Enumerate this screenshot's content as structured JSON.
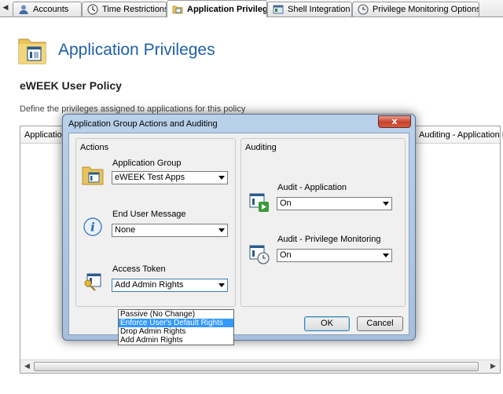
{
  "tabs": [
    {
      "label": "Accounts",
      "icon": "user-icon",
      "active": false
    },
    {
      "label": "Time Restrictions",
      "icon": "clock-icon",
      "active": false
    },
    {
      "label": "Application Privileges",
      "icon": "folder-icon",
      "active": true
    },
    {
      "label": "Shell Integration",
      "icon": "shell-icon",
      "active": false
    },
    {
      "label": "Privilege Monitoring Options",
      "icon": "monitor-clock-icon",
      "active": false
    }
  ],
  "header": {
    "title": "Application Privileges",
    "icon": "folder-app-icon",
    "policy_name": "eWEEK User Policy",
    "description": "Define the privileges assigned to applications for this policy"
  },
  "grid": {
    "columns": [
      "Application G",
      "Auditing - Application Laun"
    ]
  },
  "dialog": {
    "title": "Application Group Actions and Auditing",
    "close_label": "x",
    "actions": {
      "group_label": "Actions",
      "application_group": {
        "label": "Application Group",
        "value": "eWEEK Test Apps",
        "icon": "folder-app-icon"
      },
      "end_user_message": {
        "label": "End User Message",
        "value": "None",
        "icon": "info-icon"
      },
      "access_token": {
        "label": "Access Token",
        "value": "Add Admin Rights",
        "icon": "key-app-icon",
        "options": [
          "Passive (No Change)",
          "Enforce User's Default Rights",
          "Drop Admin Rights",
          "Add Admin Rights"
        ],
        "highlighted_option": "Enforce User's Default Rights"
      }
    },
    "auditing": {
      "group_label": "Auditing",
      "audit_application": {
        "label": "Audit - Application",
        "value": "On",
        "icon": "app-play-icon"
      },
      "audit_privilege_monitoring": {
        "label": "Audit - Privilege Monitoring",
        "value": "On",
        "icon": "app-clock-icon"
      }
    },
    "ok_label": "OK",
    "cancel_label": "Cancel"
  },
  "colors": {
    "title_blue": "#1f5fa8",
    "dialog_frame": "#b9d1ea",
    "selection": "#3399ff",
    "close_red": "#c7412c"
  }
}
